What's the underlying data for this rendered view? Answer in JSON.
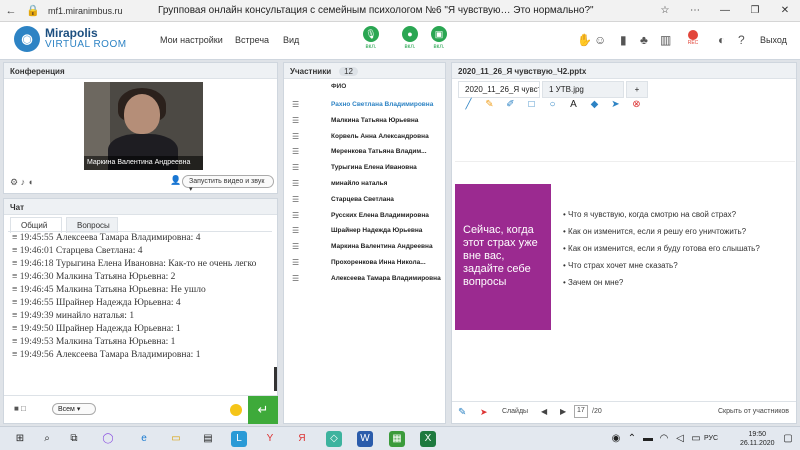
{
  "browser": {
    "url": "mf1.miranimbus.ru",
    "title": "Групповая онлайн консультация с семейным психологом №6 \"Я чувствую… Это нормально?\"",
    "more_icon": "ellipsis-icon"
  },
  "header": {
    "logo_line1": "Mirapolis",
    "logo_line2": "VIRTUAL ROOM",
    "menu": [
      "Мои настройки",
      "Встреча",
      "Вид"
    ],
    "devices": [
      {
        "icon": "microphone-icon",
        "label": "вкл."
      },
      {
        "icon": "webcam-icon",
        "label": "вкл."
      },
      {
        "icon": "screen-share-icon",
        "label": "вкл."
      }
    ],
    "rec_label": "REC",
    "exit_label": "Выход",
    "help_icon": "help-icon"
  },
  "conference": {
    "title": "Конференция",
    "video_name": "Маркина Валентина Андреевна",
    "start_video_label": "Запустить видео и звук"
  },
  "chat": {
    "title": "Чат",
    "tabs": [
      "Общий",
      "Вопросы"
    ],
    "messages": [
      {
        "time": "19:45:55",
        "text": "Алексеева Тамара Владимировна: 4"
      },
      {
        "time": "19:46:01",
        "text": "Старцева Светлана: 4"
      },
      {
        "time": "19:46:18",
        "text": "Турыгина Елена Ивановна: Как-то не очень легко"
      },
      {
        "time": "19:46:30",
        "text": "Малкина Татьяна Юрьевна: 2"
      },
      {
        "time": "19:46:45",
        "text": "Малкина Татьяна Юрьевна: Не ушло"
      },
      {
        "time": "19:46:55",
        "text": "Шрайнер Надежда Юрьевна: 4"
      },
      {
        "time": "19:49:39",
        "text": "минайло наталья: 1"
      },
      {
        "time": "19:49:50",
        "text": "Шрайнер Надежда Юрьевна: 1"
      },
      {
        "time": "19:49:53",
        "text": "Малкина Татьяна Юрьевна: 1"
      },
      {
        "time": "19:49:56",
        "text": "Алексеева Тамара Владимировна: 1"
      }
    ],
    "recipient": "Всем",
    "input_value": ""
  },
  "participants": {
    "title": "Участники",
    "count": "12",
    "column_header": "ФИО",
    "names": [
      "Рахно Светлана Владимировна",
      "Малкина Татьяна Юрьевна",
      "Корвель Анна Александровна",
      "Меренкова Татьяна Владим...",
      "Турыгина Елена Ивановна",
      "минайло наталья",
      "Старцева Светлана",
      "Русских Елена Владимировна",
      "Шрайнер Надежда Юрьевна",
      "Маркина Валентина Андреевна",
      "Прохоренкова Инна Никола...",
      "Алексеева Тамара Владимировна"
    ]
  },
  "presentation": {
    "title": "2020_11_26_Я чувствую_Ч2.pptx",
    "tabs": [
      "2020_11_26_Я чувствую_...",
      "1 УТВ.jpg",
      "+"
    ],
    "slide_box_text": "Сейчас, когда этот страх уже вне вас, задайте себе вопросы",
    "slide_items": [
      "Что я чувствую, когда смотрю на свой страх?",
      "Как он изменится, если я решу его уничтожить?",
      "Как он изменится, если я буду готова его слышать?",
      "Что страх хочет мне сказать?",
      "Зачем он мне?"
    ],
    "slide_box_color": "#9b2a90",
    "footer_label": "Слайды",
    "page": "17",
    "total": "/20",
    "hide_label": "Скрыть от участников"
  },
  "taskbar": {
    "lang": "РУС",
    "time": "19:50",
    "date": "26.11.2020"
  }
}
